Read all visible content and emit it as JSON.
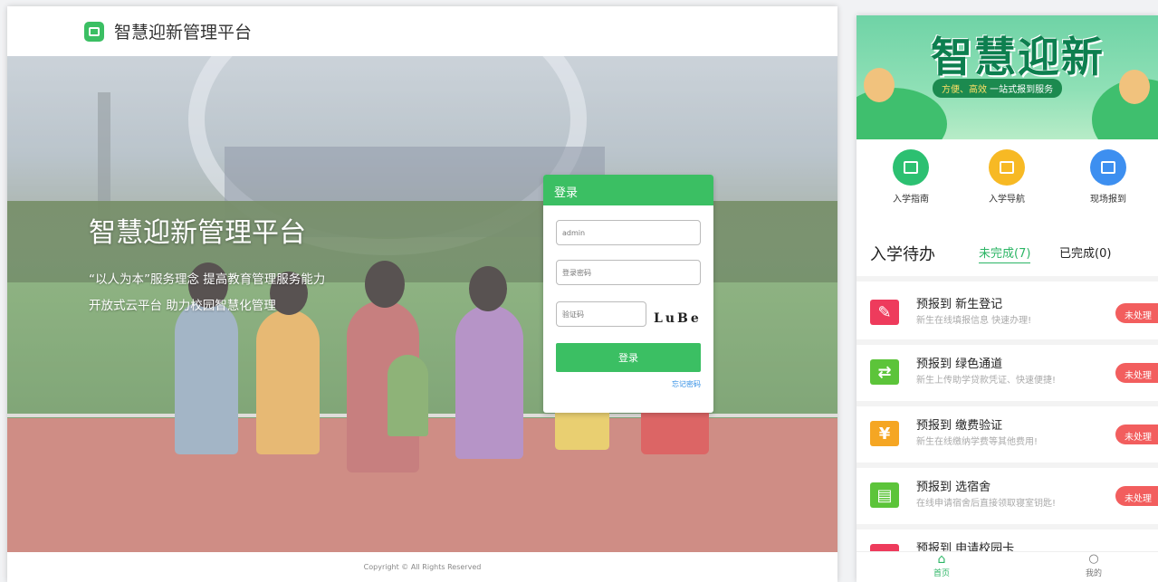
{
  "desktop": {
    "app_title": "智慧迎新管理平台",
    "hero_heading": "智慧迎新管理平台",
    "hero_line1": "“以人为本”服务理念 提高教育管理服务能力",
    "hero_line2": "开放式云平台 助力校园智慧化管理",
    "login": {
      "header": "登录",
      "username_value": "admin",
      "password_placeholder": "登录密码",
      "captcha_placeholder": "验证码",
      "captcha_text": "LuBe",
      "button_label": "登录",
      "forgot_label": "忘记密码"
    },
    "footer": "Copyright © All Rights Reserved"
  },
  "mobile": {
    "banner": {
      "title": "智慧迎新",
      "subtitle_highlight": "方便、高效",
      "subtitle_rest": " 一站式报到服务"
    },
    "shortcuts": [
      {
        "label": "入学指南",
        "color": "#2cc071",
        "icon": "guide-icon"
      },
      {
        "label": "入学导航",
        "color": "#f7b924",
        "icon": "navigation-icon"
      },
      {
        "label": "现场报到",
        "color": "#3d8ff0",
        "icon": "checkin-icon"
      }
    ],
    "todo_title": "入学待办",
    "tab_pending": "未完成(7)",
    "tab_done": "已完成(0)",
    "tasks": [
      {
        "title": "预报到  新生登记",
        "desc": "新生在线填报信息 快速办理!",
        "badge": "未处理",
        "color": "#ee3b5c",
        "icon": "edit-icon"
      },
      {
        "title": "预报到  绿色通道",
        "desc": "新生上传助学贷款凭证、快速便捷!",
        "badge": "未处理",
        "color": "#5cc43a",
        "icon": "green-channel-icon"
      },
      {
        "title": "预报到  缴费验证",
        "desc": "新生在线缴纳学费等其他费用!",
        "badge": "未处理",
        "color": "#f5a623",
        "icon": "yuan-icon"
      },
      {
        "title": "预报到  选宿舍",
        "desc": "在线申请宿舍后直接领取寝室钥匙!",
        "badge": "未处理",
        "color": "#5cc43a",
        "icon": "dorm-icon"
      },
      {
        "title": "预报到  申请校园卡",
        "desc": "",
        "badge": "",
        "color": "#ee3b5c",
        "icon": "card-icon"
      }
    ],
    "tabbar": {
      "home": "首页",
      "mine": "我的"
    },
    "colors": {
      "accent": "#2cb565",
      "badge": "#f25e5e"
    }
  }
}
